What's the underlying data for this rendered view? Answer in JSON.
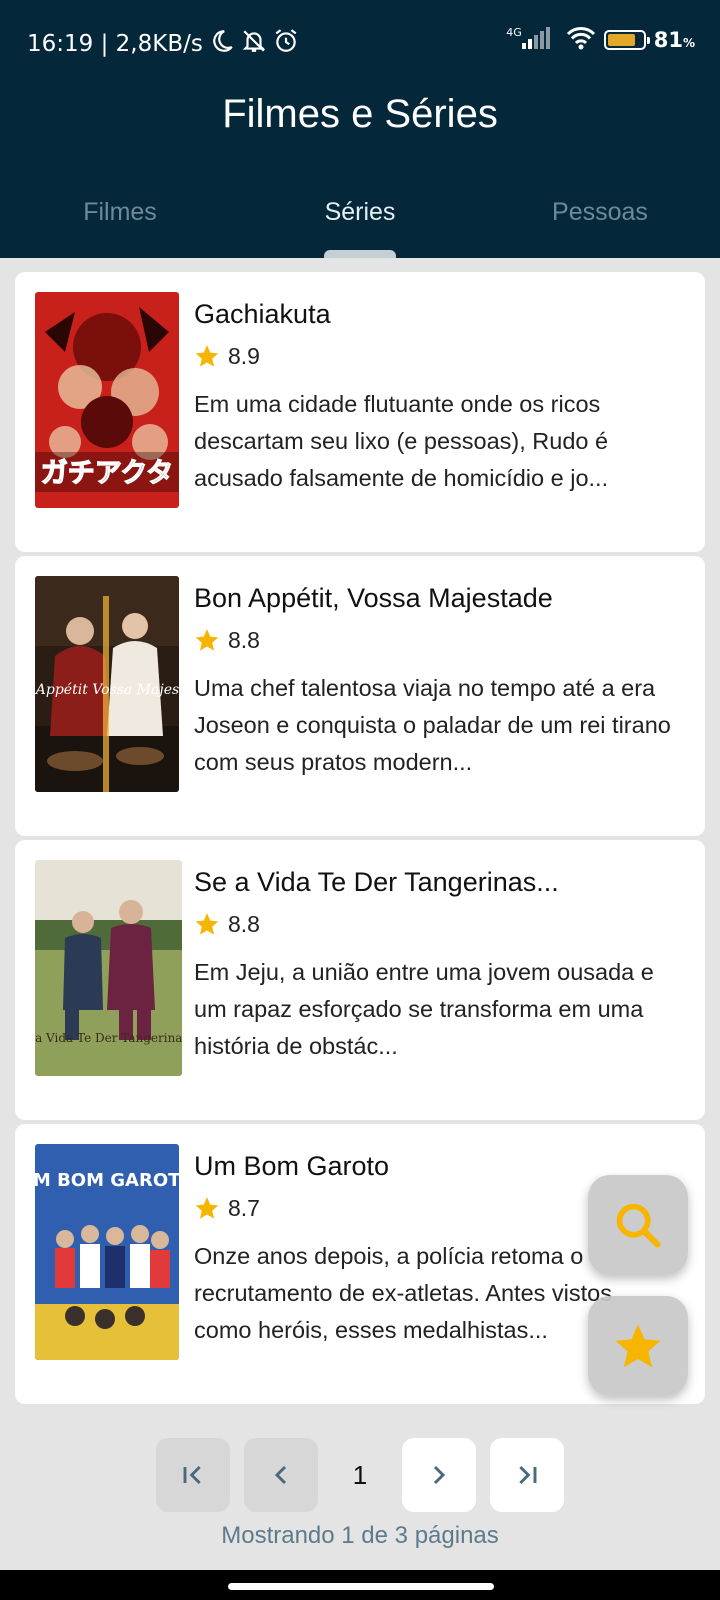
{
  "status_bar": {
    "time_speed": "16:19 | 2,8KB/s",
    "network": "4G",
    "battery_percent": "81",
    "battery_symbol": "%",
    "battery_level": 0.81
  },
  "app_title": "Filmes e Séries",
  "tabs": [
    {
      "label": "Filmes",
      "active": false
    },
    {
      "label": "Séries",
      "active": true
    },
    {
      "label": "Pessoas",
      "active": false
    }
  ],
  "series": [
    {
      "title": "Gachiakuta",
      "rating": "8.9",
      "description": "Em uma cidade flutuante onde os ricos descartam seu lixo (e pessoas), Rudo é acusado falsamente de homicídio e jo...",
      "poster_logo": "ガチアクタ"
    },
    {
      "title": "Bon Appétit, Vossa Majestade",
      "rating": "8.8",
      "description": "Uma chef talentosa viaja no tempo até a era Joseon e conquista o paladar de um rei tirano com seus pratos modern...",
      "poster_logo": "Bon Appétit Vossa Majestade"
    },
    {
      "title": "Se a Vida Te Der Tangerinas...",
      "rating": "8.8",
      "description": "Em Jeju, a união entre uma jovem ousada e um rapaz esforçado se transforma em uma história de obstác...",
      "poster_logo": "Se a Vida Te Der Tangerinas..."
    },
    {
      "title": "Um Bom Garoto",
      "rating": "8.7",
      "description": "Onze anos depois, a polícia retoma o recrutamento de ex-atletas. Antes vistos como heróis, esses medalhistas...",
      "poster_logo": "UM BOM GAROTO"
    }
  ],
  "fabs": {
    "search_icon": "search-icon",
    "favorites_icon": "star-icon"
  },
  "pagination": {
    "current_page": "1",
    "info": "Mostrando 1 de 3 páginas"
  },
  "colors": {
    "header_bg": "#04283a",
    "star": "#f7b500",
    "page_bg": "#e4e4e4",
    "muted_text": "#5e7b8c"
  }
}
